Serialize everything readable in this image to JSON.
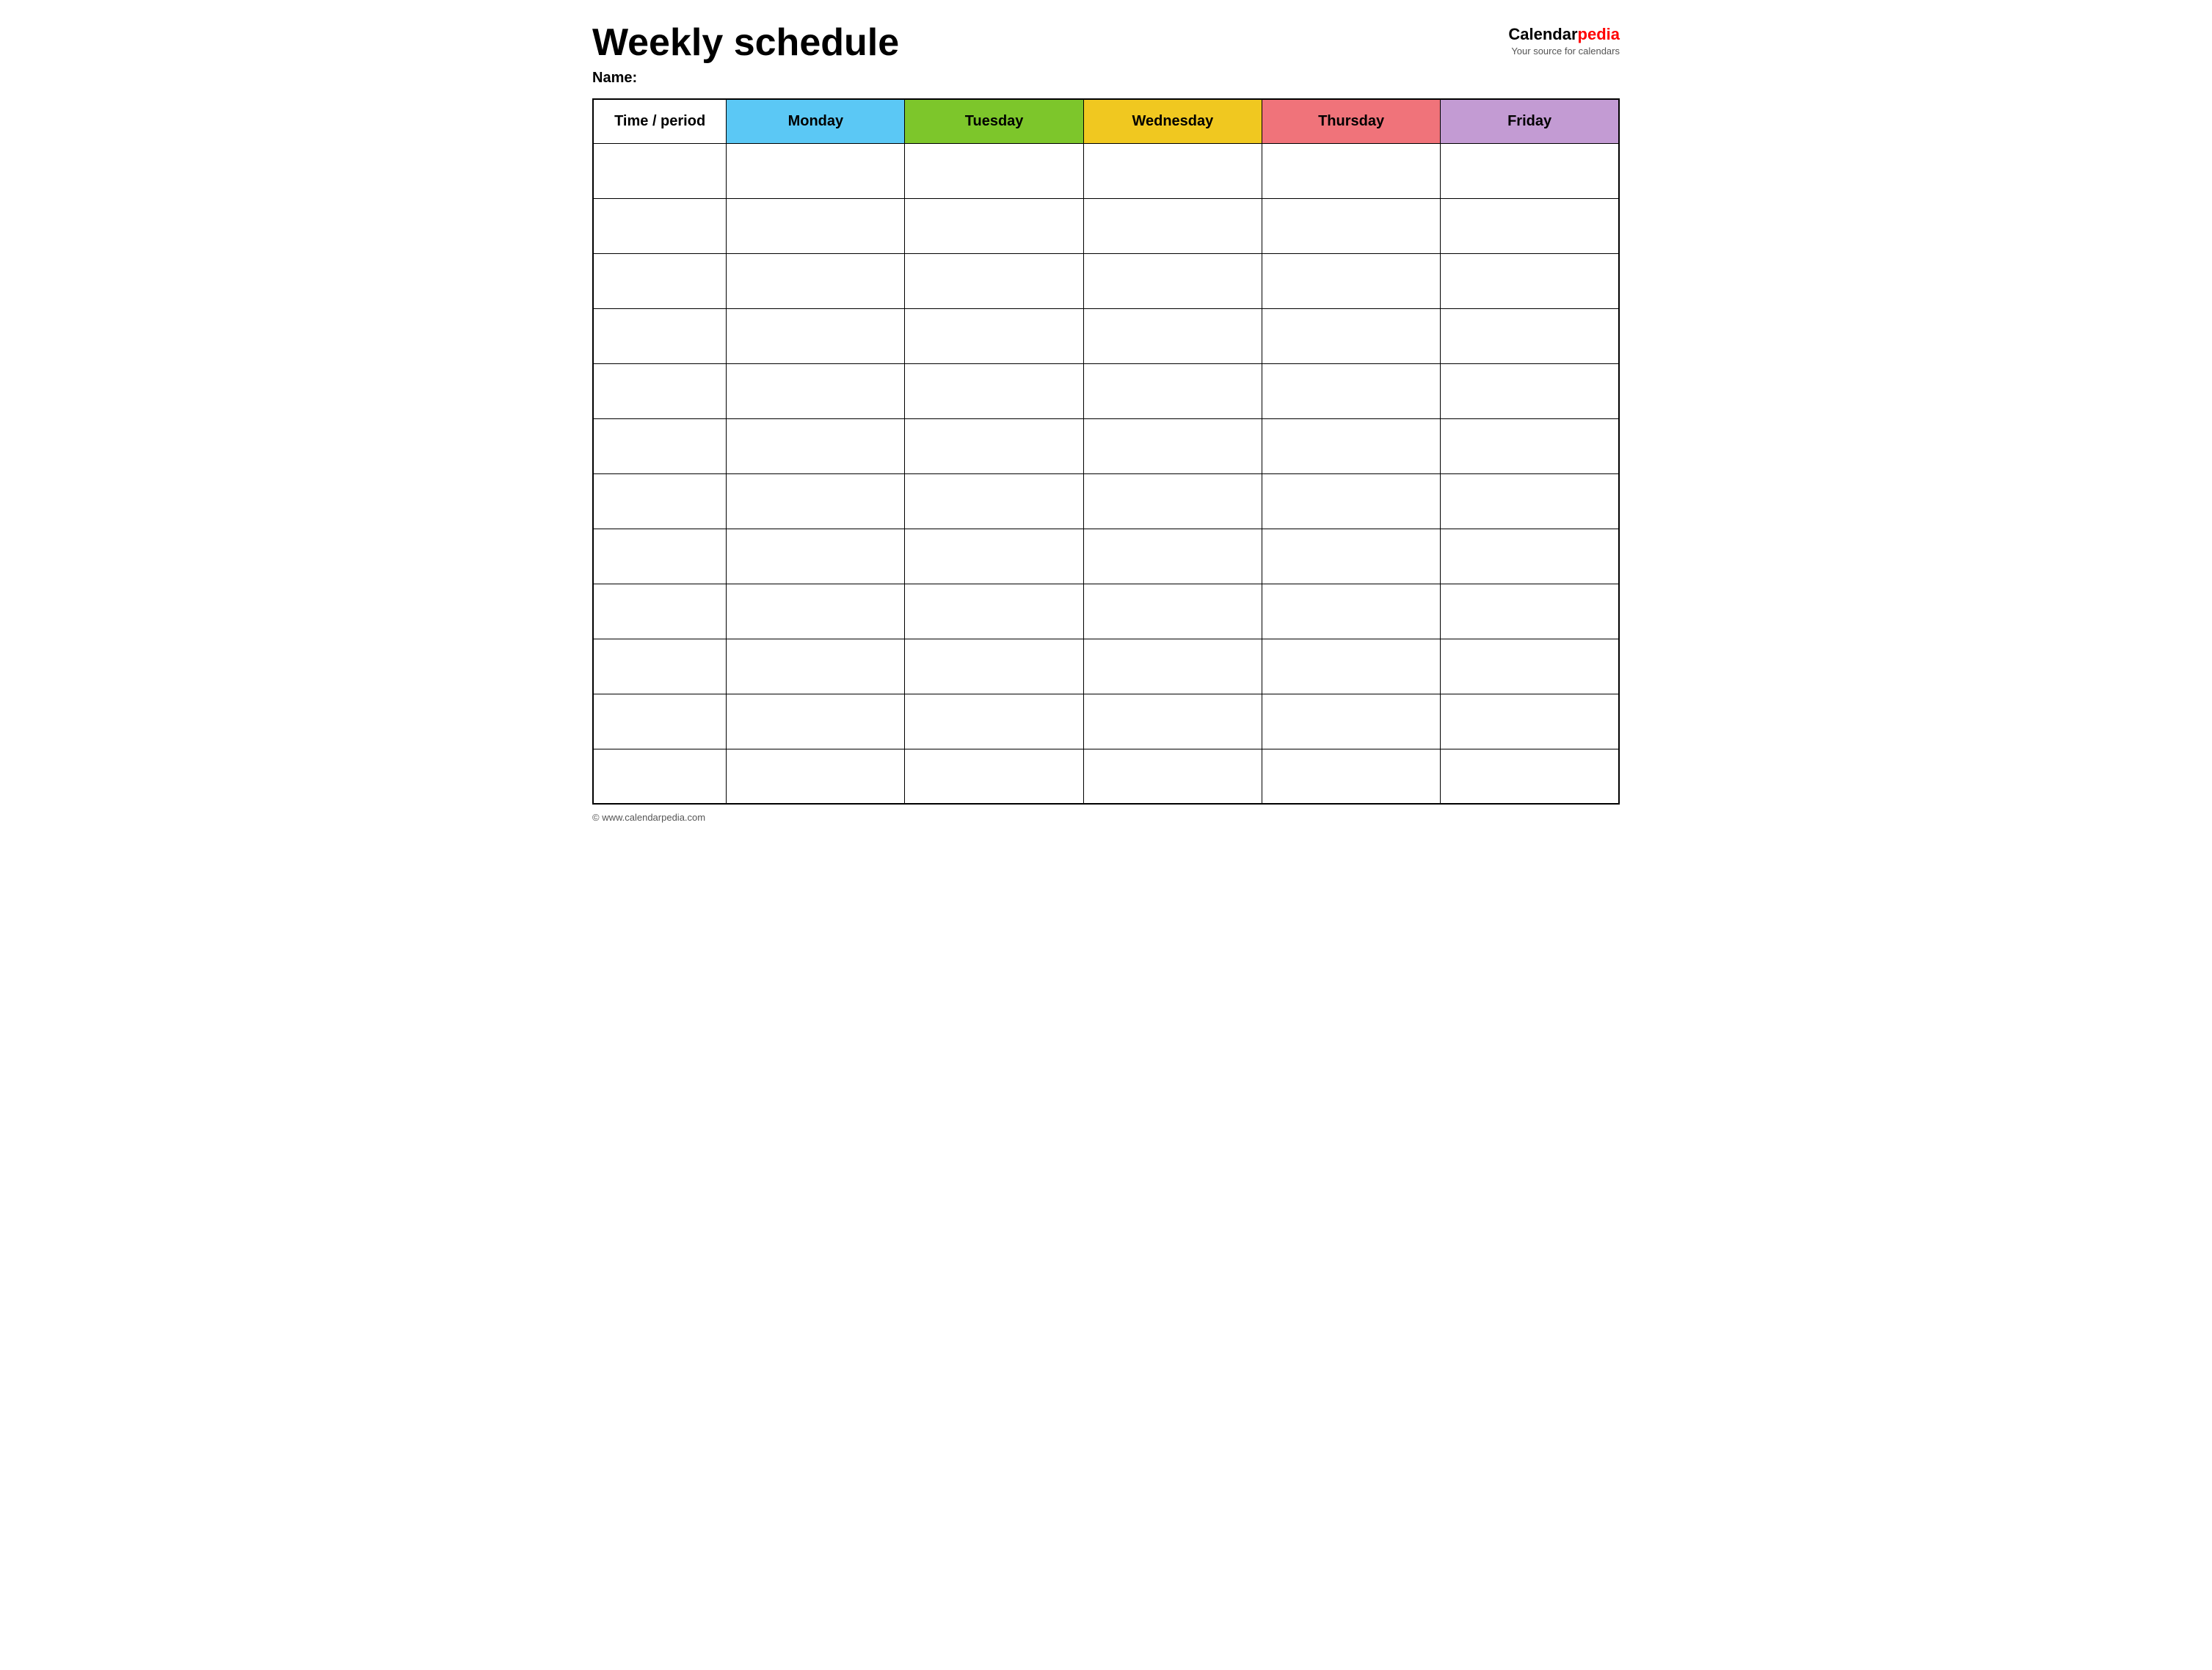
{
  "header": {
    "main_title": "Weekly schedule",
    "name_label": "Name:",
    "logo": {
      "calendar_part": "Calendar",
      "pedia_part": "pedia",
      "tagline": "Your source for calendars"
    }
  },
  "table": {
    "columns": [
      {
        "id": "time",
        "label": "Time / period",
        "color": "#ffffff",
        "class": "th-time"
      },
      {
        "id": "monday",
        "label": "Monday",
        "color": "#5bc8f5",
        "class": "th-monday"
      },
      {
        "id": "tuesday",
        "label": "Tuesday",
        "color": "#7dc62b",
        "class": "th-tuesday"
      },
      {
        "id": "wednesday",
        "label": "Wednesday",
        "color": "#f0c820",
        "class": "th-wednesday"
      },
      {
        "id": "thursday",
        "label": "Thursday",
        "color": "#f0737a",
        "class": "th-thursday"
      },
      {
        "id": "friday",
        "label": "Friday",
        "color": "#c39bd3",
        "class": "th-friday"
      }
    ],
    "row_count": 12
  },
  "footer": {
    "url": "© www.calendarpedia.com"
  }
}
